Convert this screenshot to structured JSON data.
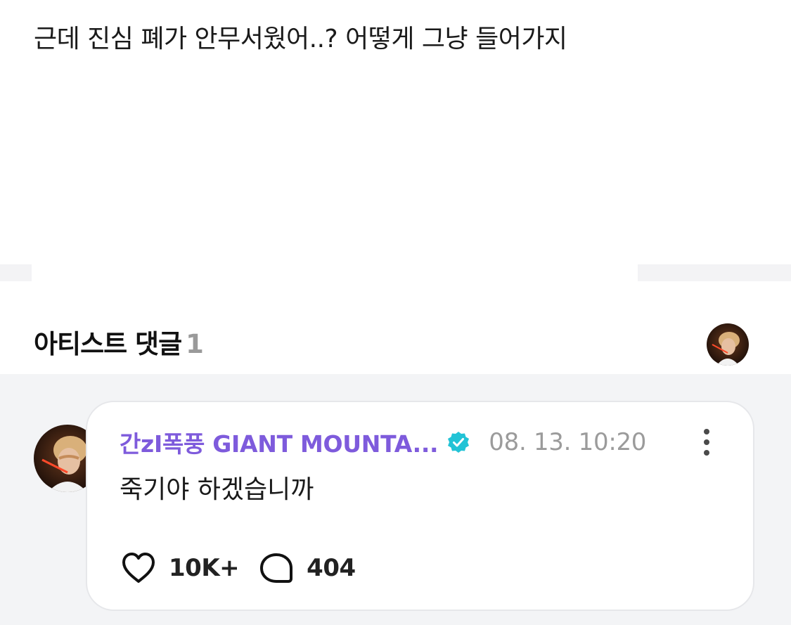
{
  "post": {
    "text": "근데 진심 폐가 안무서웠어..? 어떻게 그냥 들어가지"
  },
  "artist_comments": {
    "title": "아티스트 댓글",
    "count": "1"
  },
  "comment": {
    "author": "간zI폭풍 GIANT MOUNTA...",
    "verified_icon": "verified-check-icon",
    "timestamp": "08. 13. 10:20",
    "text": "죽기야 하겠습니까",
    "like_count": "10K+",
    "reply_count": "404"
  },
  "colors": {
    "author": "#7e5bdc",
    "verified": "#22c3d6",
    "background_gray": "#f3f4f6"
  }
}
